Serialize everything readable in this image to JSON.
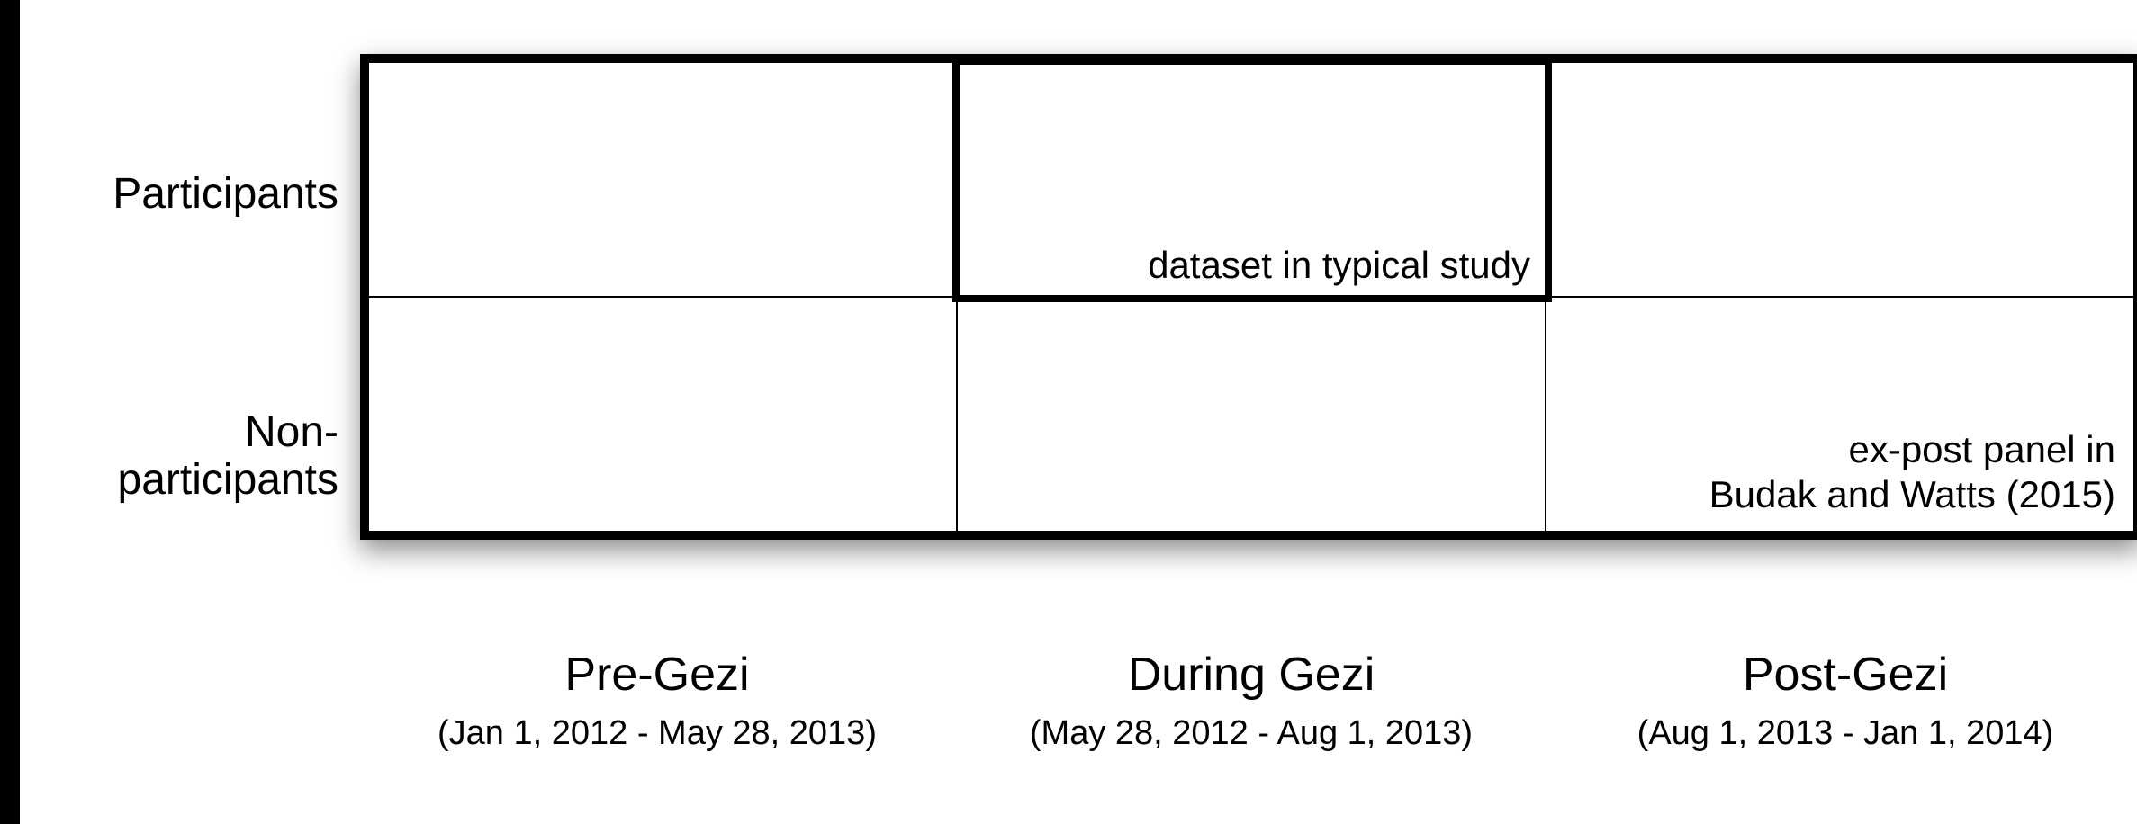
{
  "rows": [
    {
      "label": "Participants"
    },
    {
      "label": "Non-participants"
    }
  ],
  "columns": [
    {
      "label": "Pre-Gezi",
      "sub": "(Jan 1, 2012 - May 28, 2013)"
    },
    {
      "label": "During Gezi",
      "sub": "(May 28, 2012 - Aug 1, 2013)"
    },
    {
      "label": "Post-Gezi",
      "sub": "(Aug 1, 2013 - Jan 1, 2014)"
    }
  ],
  "cells": {
    "typical": "dataset in typical study",
    "expost1": "ex-post panel in",
    "expost2": "Budak and Watts (2015)"
  }
}
